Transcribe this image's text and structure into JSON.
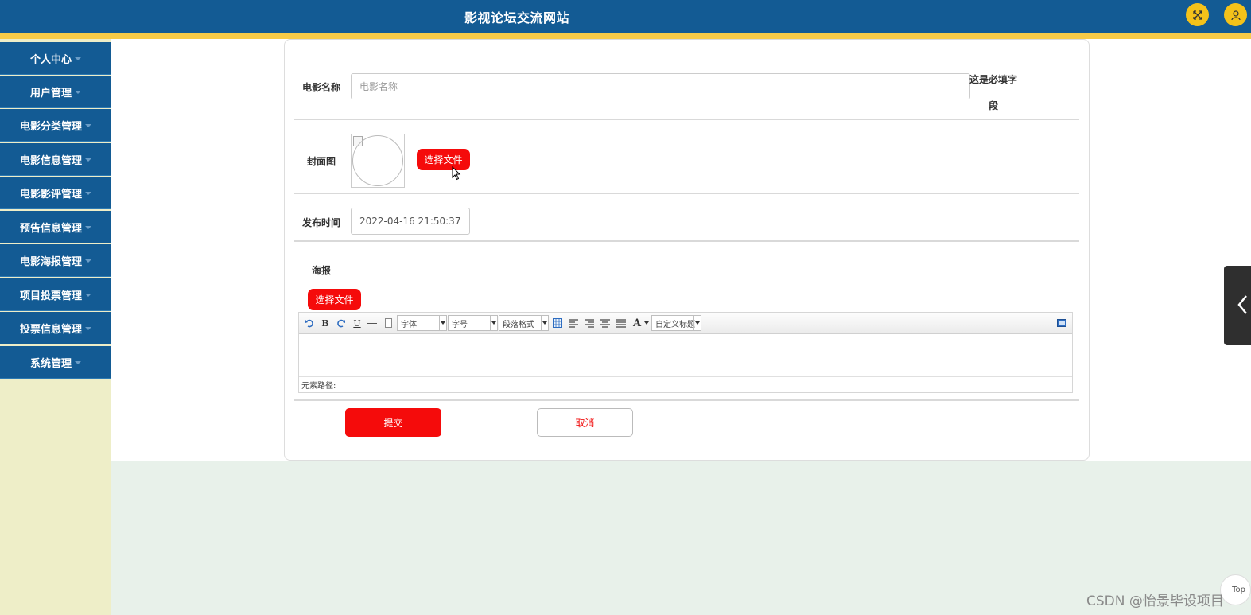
{
  "header": {
    "title": "影视论坛交流网站"
  },
  "header_icons": [
    "fullscreen-icon",
    "user-icon"
  ],
  "colors": {
    "brand_blue": "#135b94",
    "accent_yellow": "#f8cb47",
    "button_red": "#f50b0b",
    "sidebar_bg": "#eeeec8",
    "page_bg": "#e8f1ea"
  },
  "sidebar": {
    "items": [
      {
        "label": "个人中心"
      },
      {
        "label": "用户管理"
      },
      {
        "label": "电影分类管理"
      },
      {
        "label": "电影信息管理"
      },
      {
        "label": "电影影评管理"
      },
      {
        "label": "预告信息管理"
      },
      {
        "label": "电影海报管理"
      },
      {
        "label": "项目投票管理"
      },
      {
        "label": "投票信息管理"
      },
      {
        "label": "系统管理"
      }
    ]
  },
  "form": {
    "movie_name": {
      "label": "电影名称",
      "placeholder": "电影名称",
      "required_note": "这是必填字\n段"
    },
    "cover": {
      "label": "封面图",
      "upload_label": "选择文件"
    },
    "publish_time": {
      "label": "发布时间",
      "value": "2022-04-16 21:50:37"
    },
    "poster": {
      "label": "海报",
      "upload_label": "选择文件"
    },
    "editor": {
      "font_select": "字体",
      "size_select": "字号",
      "paragraph_select": "段落格式",
      "custom_title_select": "自定义标题",
      "bold": "B",
      "underline": "U",
      "font_color": "A",
      "path_label": "元素路径:"
    },
    "submit_label": "提交",
    "cancel_label": "取消"
  },
  "back_to_top": "Top",
  "watermark": "CSDN @怡景毕设项目"
}
